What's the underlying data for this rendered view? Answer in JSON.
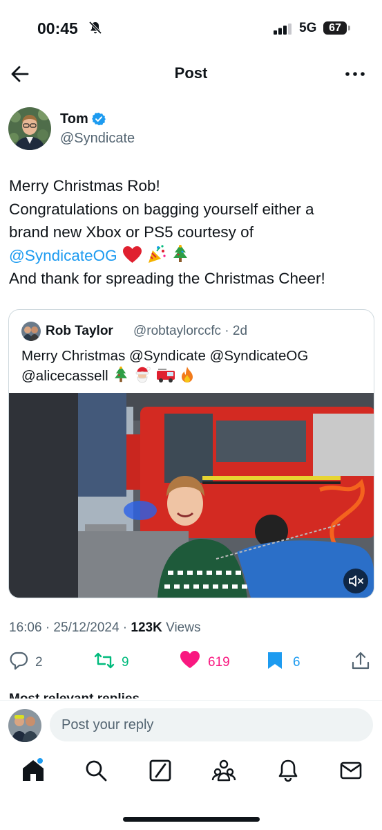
{
  "status_bar": {
    "time": "00:45",
    "network": "5G",
    "battery": "67"
  },
  "nav": {
    "title": "Post"
  },
  "author": {
    "name": "Tom",
    "handle": "@Syndicate"
  },
  "tweet": {
    "line1": "Merry Christmas Rob!",
    "line2": "Congratulations on bagging yourself either a",
    "line3": "brand new Xbox or PS5 courtesy of",
    "mention": "@SyndicateOG",
    "line5": "And thank for spreading the Christmas Cheer!"
  },
  "quote": {
    "name": "Rob Taylor",
    "handle_time": "@robtaylorccfc · 2d",
    "line1": "Merry Christmas @Syndicate @SyndicateOG",
    "line2": "@alicecassell"
  },
  "meta": {
    "time_date": "16:06 · 25/12/2024 · ",
    "views_count": "123K",
    "views_label": " Views"
  },
  "actions": {
    "replies": "2",
    "reposts": "9",
    "likes": "619",
    "bookmarks": "6"
  },
  "relevant_label": "Most relevant replies",
  "reply": {
    "placeholder": "Post your reply"
  },
  "colors": {
    "accent": "#1d9bf0",
    "like": "#f91880",
    "repost": "#00ba7c",
    "text": "#0f1419",
    "muted": "#536471"
  },
  "icons": {
    "back": "arrow-left-icon",
    "more": "more-horizontal-icon",
    "verified": "verified-badge-icon",
    "reply": "reply-bubble-icon",
    "repost": "repost-icon",
    "like": "heart-icon",
    "bookmark": "bookmark-icon",
    "share": "share-icon",
    "tabs": [
      "home-icon",
      "search-icon",
      "grok-icon",
      "communities-icon",
      "notifications-bell-icon",
      "messages-mail-icon"
    ]
  }
}
